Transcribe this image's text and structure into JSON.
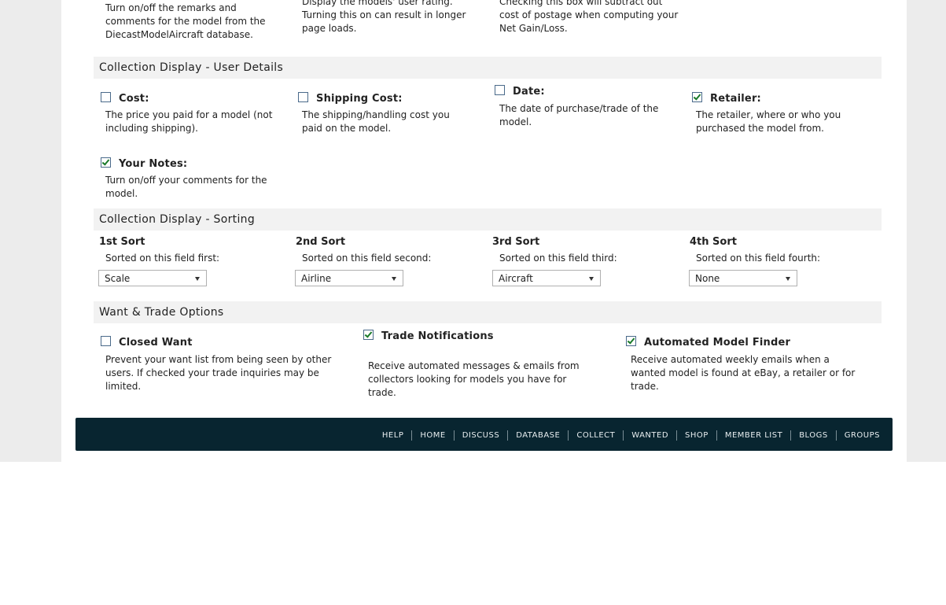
{
  "top_descriptions": {
    "col1": "Turn on/off the remarks and comments for the model from the DiecastModelAircraft database.",
    "col2": "Display the models' user rating. Turning this on can result in longer page loads.",
    "col3": "Checking this box will subtract out cost of postage when computing your Net Gain/Loss."
  },
  "user_details": {
    "title": "Collection Display - User Details",
    "options": [
      {
        "label": "Cost:",
        "desc": "The price you paid for a model (not including shipping).",
        "checked": false
      },
      {
        "label": "Shipping Cost:",
        "desc": "The shipping/handling cost you paid on the model.",
        "checked": false
      },
      {
        "label": "Date:",
        "desc": "The date of purchase/trade of the model.",
        "checked": false
      },
      {
        "label": "Retailer:",
        "desc": "The retailer, where or who you purchased the model from.",
        "checked": true
      },
      {
        "label": "Your Notes:",
        "desc": "Turn on/off your comments for the model.",
        "checked": true
      }
    ]
  },
  "sorting": {
    "title": "Collection Display - Sorting",
    "sorts": [
      {
        "title": "1st Sort",
        "desc": "Sorted on this field first:",
        "value": "Scale"
      },
      {
        "title": "2nd Sort",
        "desc": "Sorted on this field second:",
        "value": "Airline"
      },
      {
        "title": "3rd Sort",
        "desc": "Sorted on this field third:",
        "value": "Aircraft"
      },
      {
        "title": "4th Sort",
        "desc": "Sorted on this field fourth:",
        "value": "None"
      }
    ]
  },
  "want_trade": {
    "title": "Want & Trade Options",
    "options": [
      {
        "label": "Closed Want",
        "desc": "Prevent your want list from being seen by other users. If checked your trade inquiries may be limited.",
        "checked": false
      },
      {
        "label": "Trade Notifications",
        "desc": "Receive automated messages & emails from collectors looking for models you have for trade.",
        "checked": true
      },
      {
        "label": "Automated Model Finder",
        "desc": "Receive automated weekly emails when a wanted model is found at eBay, a retailer or for trade.",
        "checked": true
      }
    ]
  },
  "footer": {
    "nav": [
      "HELP",
      "HOME",
      "DISCUSS",
      "DATABASE",
      "COLLECT",
      "WANTED",
      "SHOP",
      "MEMBER LIST",
      "BLOGS",
      "GROUPS"
    ]
  },
  "colors": {
    "footer_bg": "#082530",
    "section_bg": "#f2f2f2",
    "check_green": "#1a7a2a"
  }
}
